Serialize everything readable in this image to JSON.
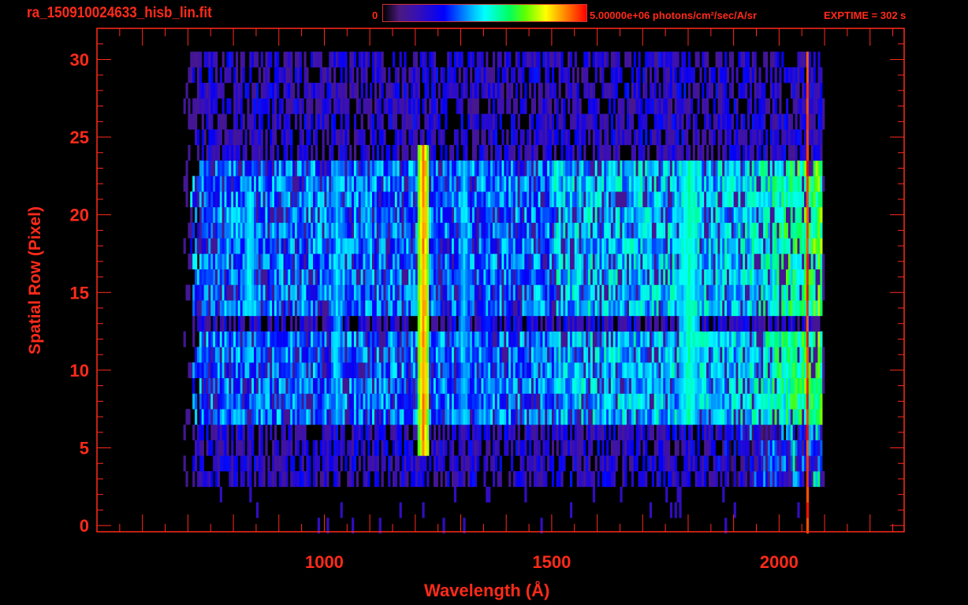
{
  "header": {
    "title": "ra_150910024633_hisb_lin.fit",
    "colorbar_min": "0",
    "colorbar_max_label": "5.00000e+06 photons/cm²/sec/A/sr",
    "exptime": "EXPTIME = 302 s"
  },
  "colors": {
    "axis": "#ff2a1a",
    "background": "#000000"
  },
  "chart_data": {
    "type": "heatmap",
    "title": "ra_150910024633_hisb_lin.fit",
    "xlabel": "Wavelength (Å)",
    "ylabel": "Spatial Row (Pixel)",
    "xlim": [
      500,
      2275
    ],
    "ylim": [
      -0.4,
      32
    ],
    "xticks": [
      1000,
      1500,
      2000
    ],
    "xtick_labels": [
      "1000",
      "1500",
      "2000"
    ],
    "yticks": [
      0,
      5,
      10,
      15,
      20,
      25,
      30
    ],
    "ytick_labels": [
      "0",
      "5",
      "10",
      "15",
      "20",
      "25",
      "30"
    ],
    "colorbar": {
      "min": 0,
      "max": 5000000,
      "units": "photons/cm^2/sec/A/sr",
      "colormap": "rainbow"
    },
    "data_wavelength_range": [
      690,
      2100
    ],
    "data_rows": [
      3,
      30
    ],
    "bright_rows": [
      7,
      23
    ],
    "dim_row": 13,
    "emission_features": [
      {
        "wavelength": 834,
        "rows": [
          14,
          21
        ],
        "level": 0.55
      },
      {
        "wavelength": 1026,
        "rows": [
          7,
          23
        ],
        "level": 0.5
      },
      {
        "wavelength": 1216,
        "rows": [
          5,
          24
        ],
        "level": 0.95
      },
      {
        "wavelength": 1304,
        "rows": [
          7,
          23
        ],
        "level": 0.5
      },
      {
        "wavelength": 1356,
        "rows": [
          7,
          23
        ],
        "level": 0.4
      },
      {
        "wavelength": 1800,
        "rows": [
          7,
          23
        ],
        "level": 0.6
      },
      {
        "wavelength": 2060,
        "rows": [
          0,
          30
        ],
        "level": 1.0
      }
    ]
  }
}
